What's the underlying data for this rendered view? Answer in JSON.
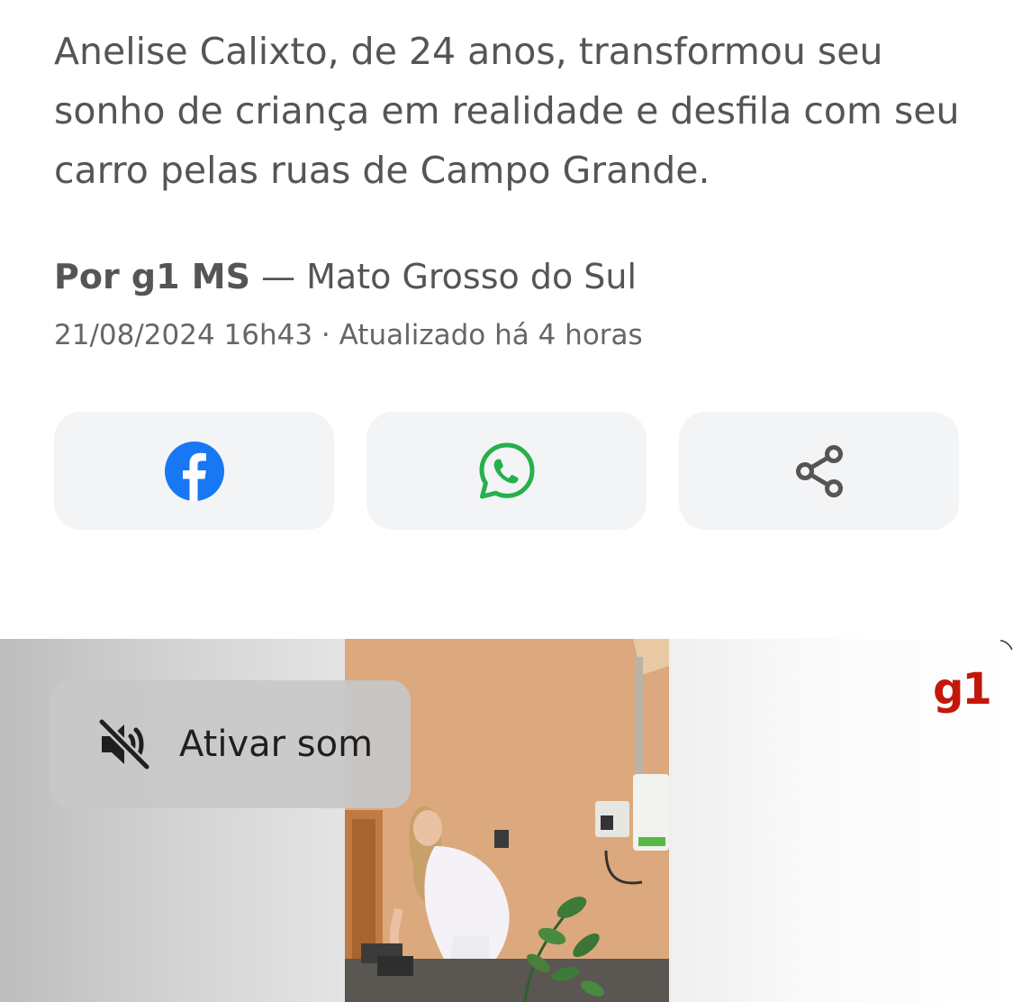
{
  "article": {
    "summary": "Anelise Calixto, de 24 anos, transformou seu sonho de criança em realidade e desfila com seu carro pelas ruas de Campo Grande.",
    "byline_author": "Por g1 MS",
    "byline_location": " — Mato Grosso do Sul",
    "published": "21/08/2024 16h43",
    "updated": " · Atualizado há 4 horas"
  },
  "share": {
    "facebook_icon": "facebook-icon",
    "whatsapp_icon": "whatsapp-icon",
    "share_icon": "share-icon",
    "colors": {
      "facebook": "#1877f2",
      "whatsapp": "#25b04c",
      "share": "#555555"
    }
  },
  "video": {
    "sound_label": "Ativar som",
    "sound_icon": "volume-mute-icon",
    "brand_logo": "g1",
    "brand_color": "#c4170c"
  }
}
